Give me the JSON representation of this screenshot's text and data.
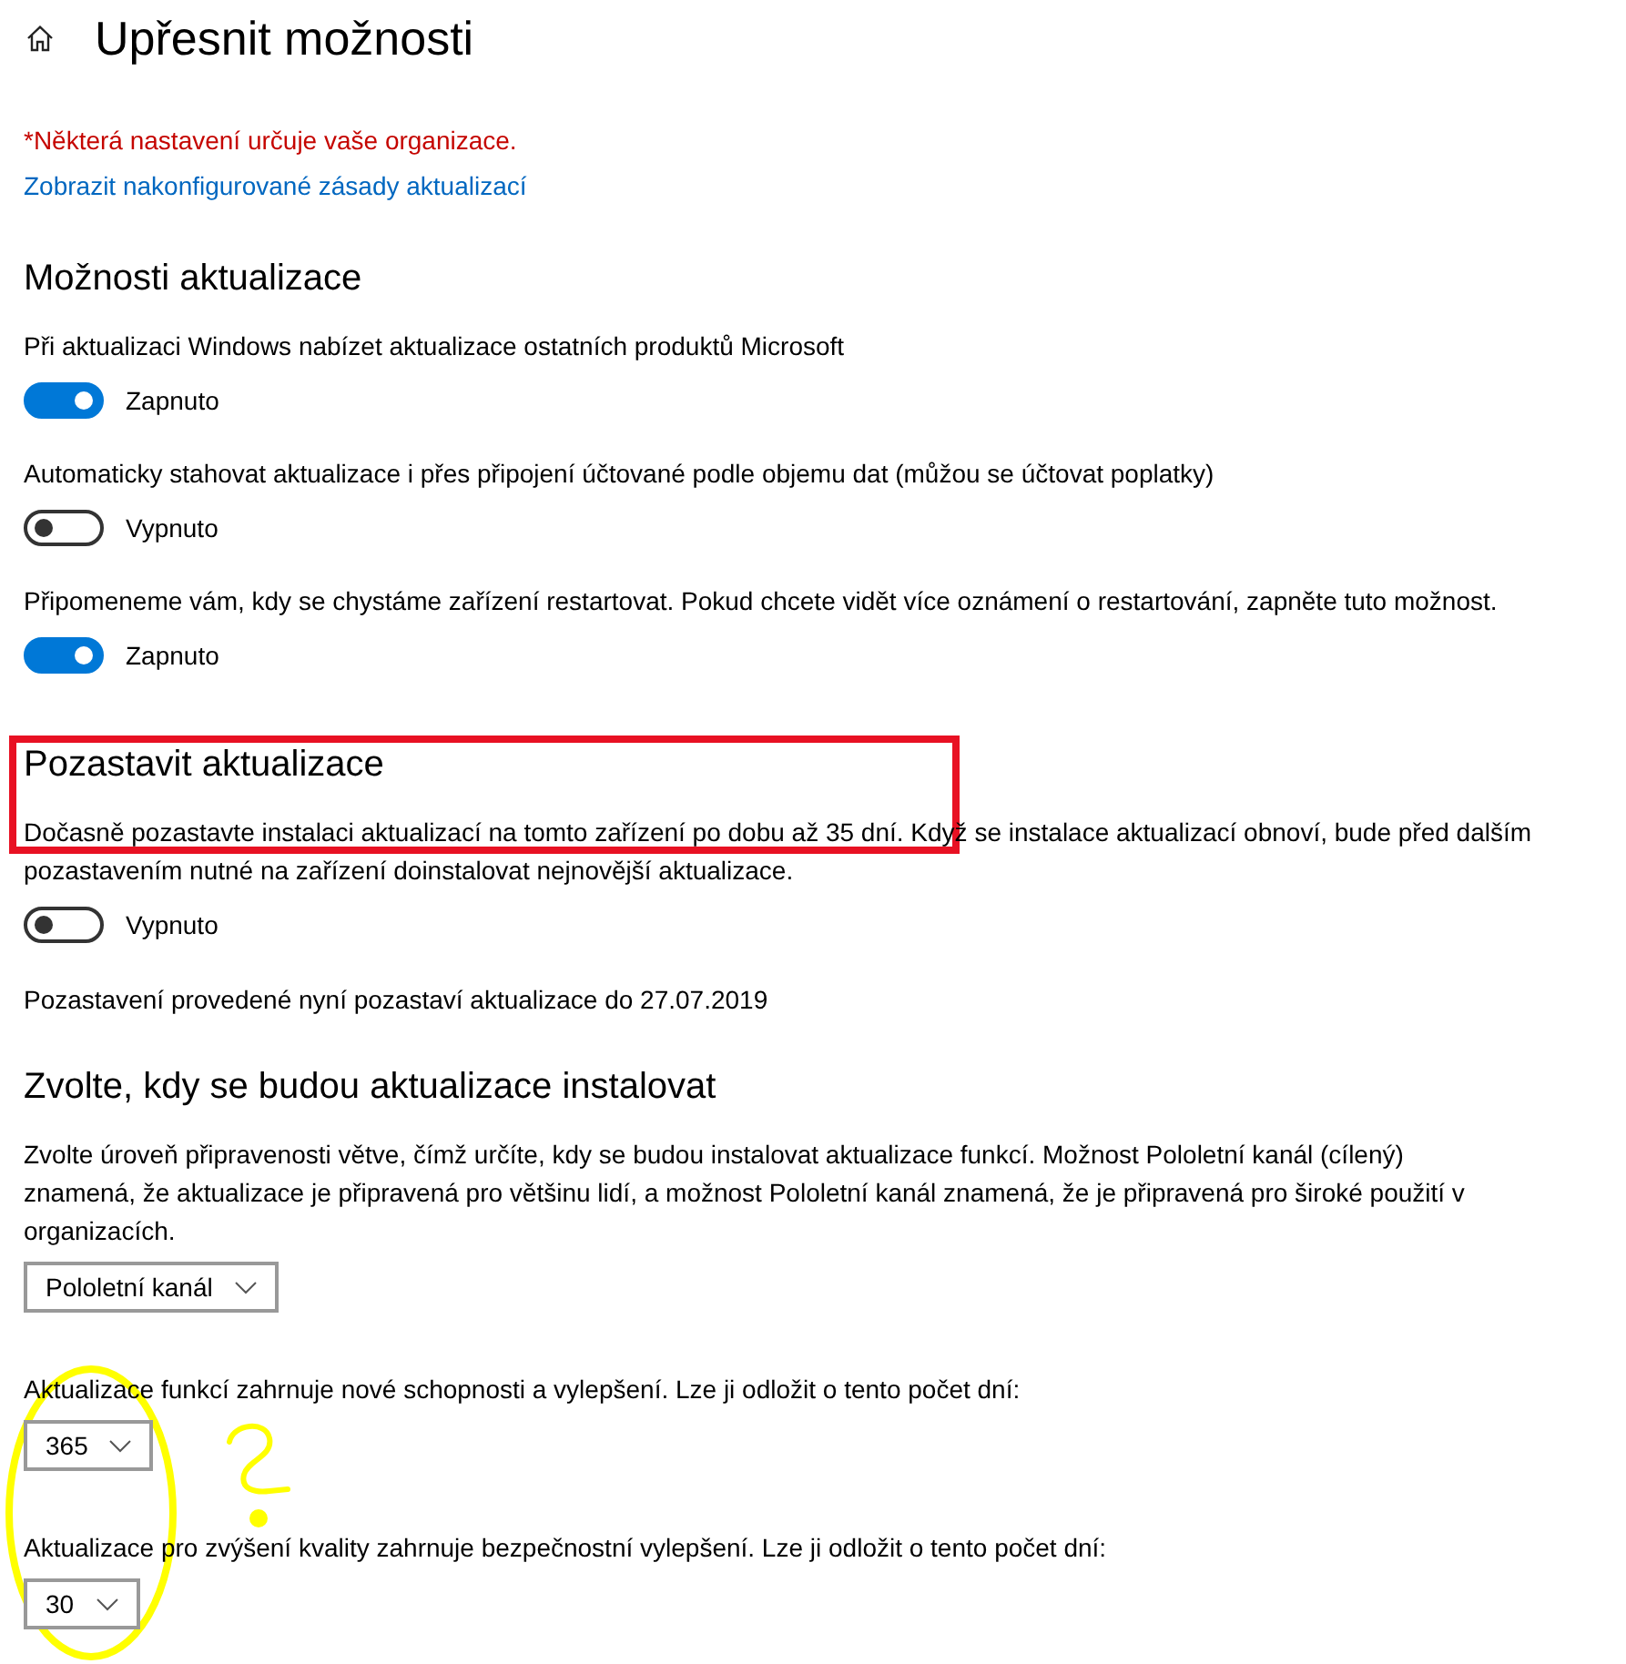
{
  "page": {
    "title": "Upřesnit možnosti"
  },
  "notice": {
    "text": "*Některá nastavení určuje vaše organizace.",
    "link": "Zobrazit nakonfigurované zásady aktualizací"
  },
  "sections": [
    {
      "heading": "Možnosti aktualizace",
      "items": [
        {
          "kind": "toggle",
          "label": "Při aktualizaci Windows nabízet aktualizace ostatních produktů Microsoft",
          "on": true,
          "state_text": "Zapnuto"
        },
        {
          "kind": "toggle",
          "label": "Automaticky stahovat aktualizace i přes připojení účtované podle objemu dat (můžou se účtovat poplatky)",
          "on": false,
          "state_text": "Vypnuto"
        },
        {
          "kind": "toggle",
          "label": "Připomeneme vám, kdy se chystáme zařízení restartovat. Pokud chcete vidět více oznámení o restartování, zapněte tuto možnost.",
          "on": true,
          "state_text": "Zapnuto"
        }
      ]
    },
    {
      "heading": "Pozastavit aktualizace",
      "items": [
        {
          "kind": "toggle",
          "label": "Dočasně pozastavte instalaci aktualizací na tomto zařízení po dobu až 35 dní. Když se instalace aktualizací obnoví, bude před dalším pozastavením nutné na zařízení doinstalovat nejnovější aktualizace.",
          "on": false,
          "state_text": "Vypnuto"
        },
        {
          "kind": "text",
          "text": "Pozastavení provedené nyní pozastaví aktualizace do 27.07.2019"
        }
      ]
    },
    {
      "heading": "Zvolte, kdy se budou aktualizace instalovat",
      "items": [
        {
          "kind": "dropdown",
          "label": "Zvolte úroveň připravenosti větve, čímž určíte, kdy se budou instalovat aktualizace funkcí. Možnost Pololetní kanál (cílený) znamená, že aktualizace je připravená pro většinu lidí, a možnost Pololetní kanál znamená, že je připravená pro široké použití v organizacích.",
          "value": "Pololetní kanál"
        },
        {
          "kind": "dropdown",
          "label": "Aktualizace funkcí zahrnuje nové schopnosti a vylepšení. Lze ji odložit o tento počet dní:",
          "value": "365"
        },
        {
          "kind": "dropdown",
          "label": "Aktualizace pro zvýšení kvality zahrnuje bezpečnostní vylepšení. Lze ji odložit o tento počet dní:",
          "value": "30"
        }
      ]
    }
  ],
  "annotations": [
    {
      "kind": "box",
      "color": "#e81123"
    },
    {
      "kind": "ellipse",
      "color": "#ffff00"
    },
    {
      "kind": "question",
      "color": "#ffff00"
    }
  ]
}
